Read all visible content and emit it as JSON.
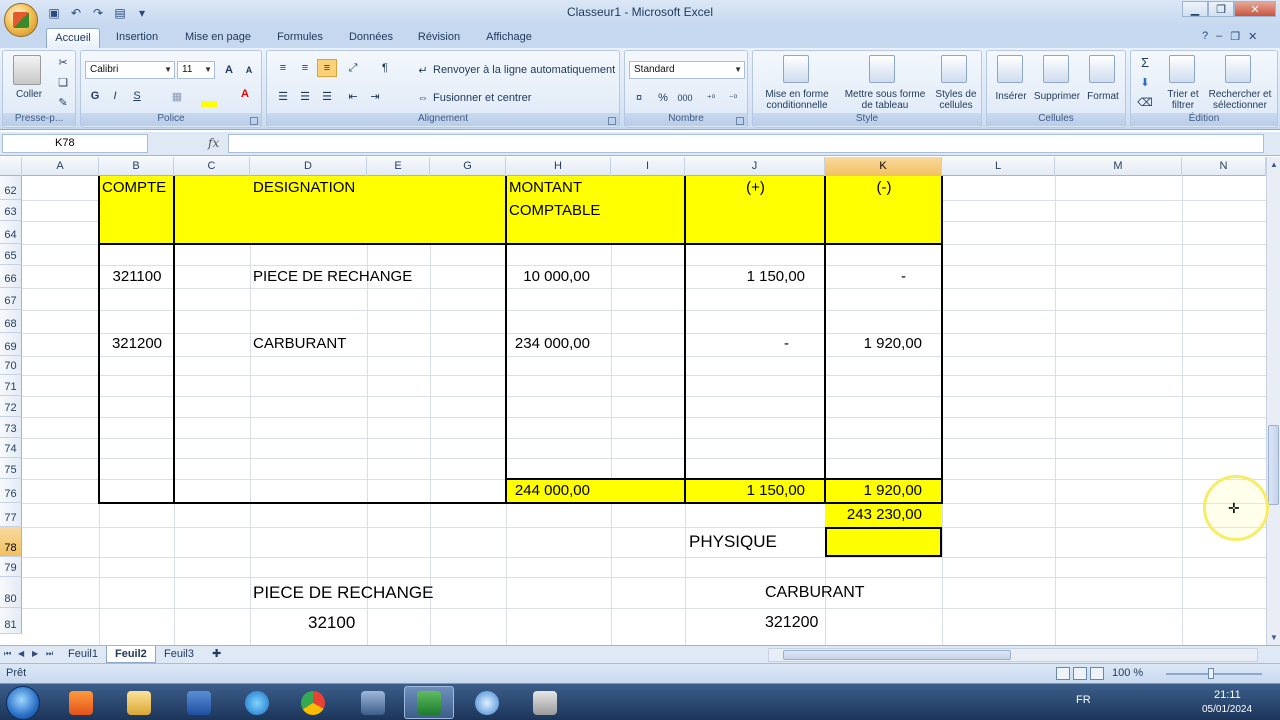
{
  "window": {
    "title": "Classeur1 - Microsoft Excel"
  },
  "tabs": [
    "Accueil",
    "Insertion",
    "Mise en page",
    "Formules",
    "Données",
    "Révision",
    "Affichage"
  ],
  "ribbon": {
    "clipboard": {
      "label": "Presse-p...",
      "paste": "Coller"
    },
    "font": {
      "label": "Police",
      "name": "Calibri",
      "size": "11"
    },
    "alignment": {
      "label": "Alignement",
      "wrap": "Renvoyer à la ligne automatiquement",
      "merge": "Fusionner et centrer"
    },
    "number": {
      "label": "Nombre",
      "format": "Standard"
    },
    "style": {
      "label": "Style",
      "cond_line1": "Mise en forme",
      "cond_line2": "conditionnelle",
      "table_line1": "Mettre sous forme",
      "table_line2": "de tableau",
      "cells_line1": "Styles de",
      "cells_line2": "cellules"
    },
    "cells": {
      "label": "Cellules",
      "insert": "Insérer",
      "delete": "Supprimer",
      "format": "Format"
    },
    "edit": {
      "label": "Édition",
      "sort_line1": "Trier et",
      "sort_line2": "filtrer",
      "find_line1": "Rechercher et",
      "find_line2": "sélectionner"
    }
  },
  "formula_bar": {
    "name_box": "K78",
    "fx": "fx",
    "value": ""
  },
  "columns": [
    "A",
    "B",
    "C",
    "D",
    "E",
    "G",
    "H",
    "I",
    "J",
    "K",
    "L",
    "M",
    "N"
  ],
  "rows": [
    "62",
    "63",
    "64",
    "65",
    "66",
    "67",
    "68",
    "69",
    "70",
    "71",
    "72",
    "73",
    "74",
    "75",
    "76",
    "77",
    "78",
    "79",
    "80",
    "81"
  ],
  "sheet": {
    "header_compte": "COMPTE",
    "header_designation": "DESIGNATION",
    "header_montant_1": "MONTANT",
    "header_montant_2": "COMPTABLE",
    "header_plus": "(+)",
    "header_minus": "(-)",
    "row66": {
      "compte": "321100",
      "designation": "PIECE  DE RECHANGE",
      "montant": "10 000,00",
      "plus": "1 150,00",
      "minus": "-"
    },
    "row69": {
      "compte": "321200",
      "designation": "CARBURANT",
      "montant": "234 000,00",
      "plus": "-",
      "minus": "1 920,00"
    },
    "row76": {
      "montant": "244 000,00",
      "plus": "1 150,00",
      "minus": "1 920,00"
    },
    "row77": {
      "value": "243 230,00"
    },
    "row78": {
      "label": "PHYSIQUE"
    },
    "row80": {
      "left": "PIECE DE RECHANGE",
      "right": "CARBURANT"
    },
    "row81": {
      "left": "32100",
      "right": "321200"
    }
  },
  "sheet_tabs": [
    "Feuil1",
    "Feuil2",
    "Feuil3"
  ],
  "status": {
    "text": "Prêt",
    "zoom": "100 %"
  },
  "taskbar": {
    "lang": "FR",
    "time": "21:11",
    "date": "05/01/2024"
  }
}
